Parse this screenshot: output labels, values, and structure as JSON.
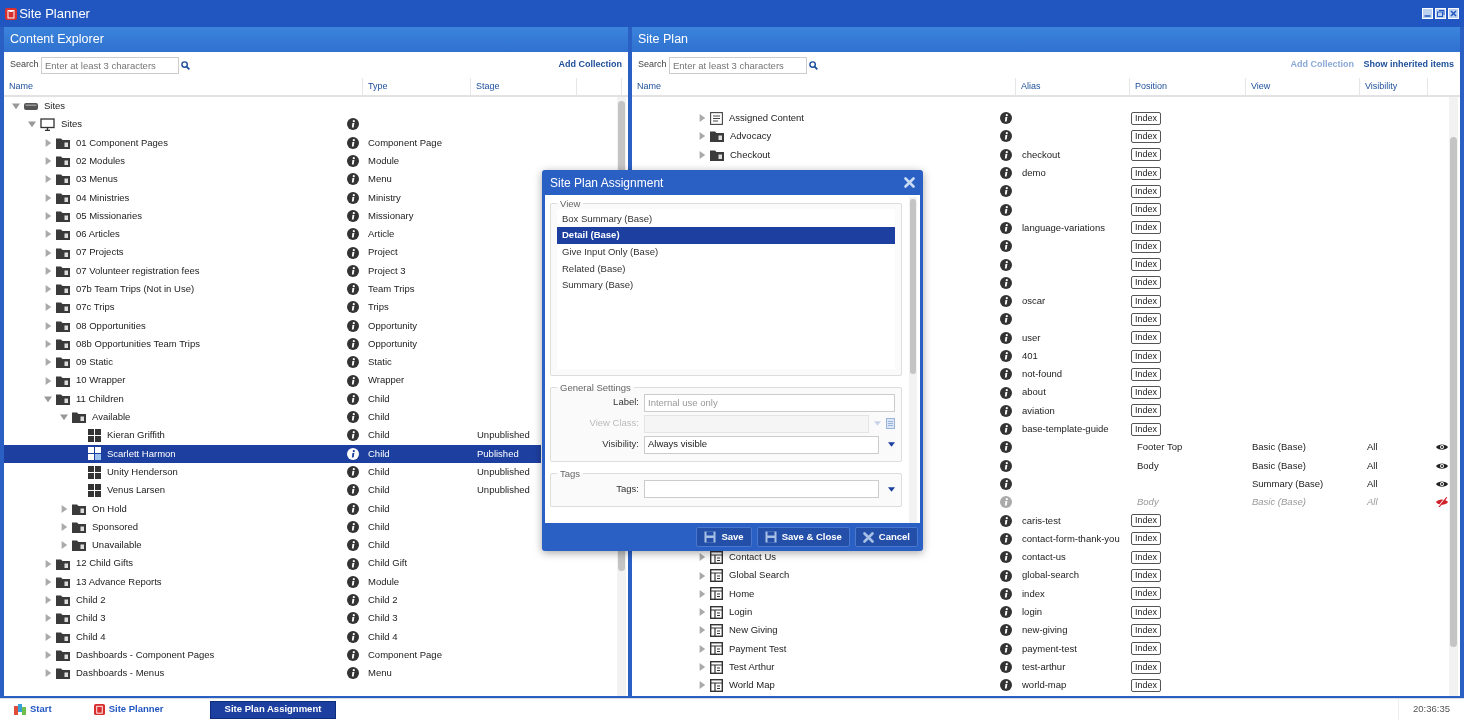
{
  "app": {
    "title": "Site Planner"
  },
  "content_explorer": {
    "title": "Content Explorer",
    "search": {
      "label": "Search",
      "placeholder": "Enter at least 3 characters"
    },
    "add_collection": "Add Collection",
    "columns": [
      "Name",
      "Type",
      "Stage"
    ],
    "tree": [
      {
        "name": "Sites",
        "kind": "root",
        "expanded": true,
        "selected": false,
        "children": [
          {
            "name": "Sites",
            "kind": "site",
            "expanded": true,
            "selected": false,
            "children": [
              {
                "name": "01 Component Pages",
                "type": "Component Page",
                "kind": "folder",
                "expanded": false,
                "selected": false
              },
              {
                "name": "02 Modules",
                "type": "Module",
                "kind": "folder",
                "expanded": false,
                "selected": false
              },
              {
                "name": "03 Menus",
                "type": "Menu",
                "kind": "folder",
                "expanded": false,
                "selected": false
              },
              {
                "name": "04 Ministries",
                "type": "Ministry",
                "kind": "folder",
                "expanded": false,
                "selected": false
              },
              {
                "name": "05 Missionaries",
                "type": "Missionary",
                "kind": "folder",
                "expanded": false,
                "selected": false
              },
              {
                "name": "06 Articles",
                "type": "Article",
                "kind": "folder",
                "expanded": false,
                "selected": false
              },
              {
                "name": "07 Projects",
                "type": "Project",
                "kind": "folder",
                "expanded": false,
                "selected": false
              },
              {
                "name": "07 Volunteer registration fees",
                "type": "Project 3",
                "kind": "folder",
                "expanded": false,
                "selected": false
              },
              {
                "name": "07b Team Trips (Not in Use)",
                "type": "Team Trips",
                "kind": "folder",
                "expanded": false,
                "selected": false
              },
              {
                "name": "07c Trips",
                "type": "Trips",
                "kind": "folder",
                "expanded": false,
                "selected": false
              },
              {
                "name": "08 Opportunities",
                "type": "Opportunity",
                "kind": "folder",
                "expanded": false,
                "selected": false
              },
              {
                "name": "08b Opportunities Team Trips",
                "type": "Opportunity",
                "kind": "folder",
                "expanded": false,
                "selected": false
              },
              {
                "name": "09 Static",
                "type": "Static",
                "kind": "folder",
                "expanded": false,
                "selected": false
              },
              {
                "name": "10 Wrapper",
                "type": "Wrapper",
                "kind": "folder",
                "expanded": false,
                "selected": false
              },
              {
                "name": "11 Children",
                "type": "Child",
                "kind": "folder",
                "expanded": true,
                "selected": false,
                "children": [
                  {
                    "name": "Available",
                    "type": "Child",
                    "kind": "folder",
                    "expanded": true,
                    "selected": false,
                    "children": [
                      {
                        "name": "Kieran Griffith",
                        "type": "Child",
                        "stage": "Unpublished",
                        "kind": "person",
                        "selected": false
                      },
                      {
                        "name": "Scarlett Harmon",
                        "type": "Child",
                        "stage": "Published",
                        "kind": "person",
                        "selected": true
                      },
                      {
                        "name": "Unity Henderson",
                        "type": "Child",
                        "stage": "Unpublished",
                        "kind": "person",
                        "selected": false
                      },
                      {
                        "name": "Venus Larsen",
                        "type": "Child",
                        "stage": "Unpublished",
                        "kind": "person",
                        "selected": false
                      }
                    ]
                  },
                  {
                    "name": "On Hold",
                    "type": "Child",
                    "kind": "folder",
                    "expanded": false,
                    "selected": false
                  },
                  {
                    "name": "Sponsored",
                    "type": "Child",
                    "kind": "folder",
                    "expanded": false,
                    "selected": false
                  },
                  {
                    "name": "Unavailable",
                    "type": "Child",
                    "kind": "folder",
                    "expanded": false,
                    "selected": false
                  }
                ]
              },
              {
                "name": "12 Child Gifts",
                "type": "Child Gift",
                "kind": "folder",
                "expanded": false,
                "selected": false
              },
              {
                "name": "13 Advance Reports",
                "type": "Module",
                "kind": "folder",
                "expanded": false,
                "selected": false
              },
              {
                "name": "Child 2",
                "type": "Child 2",
                "kind": "folder",
                "expanded": false,
                "selected": false
              },
              {
                "name": "Child 3",
                "type": "Child 3",
                "kind": "folder",
                "expanded": false,
                "selected": false
              },
              {
                "name": "Child 4",
                "type": "Child 4",
                "kind": "folder",
                "expanded": false,
                "selected": false
              },
              {
                "name": "Dashboards - Component Pages",
                "type": "Component Page",
                "kind": "folder",
                "expanded": false,
                "selected": false
              },
              {
                "name": "Dashboards - Menus",
                "type": "Menu",
                "kind": "folder",
                "expanded": false,
                "selected": false
              }
            ]
          }
        ]
      }
    ]
  },
  "site_plan": {
    "title": "Site Plan",
    "search": {
      "label": "Search",
      "placeholder": "Enter at least 3 characters"
    },
    "actions": [
      {
        "label": "Add Collection",
        "disabled": true
      },
      {
        "label": "Show inherited items",
        "disabled": false
      }
    ],
    "columns": [
      "Name",
      "Alias",
      "Position",
      "View",
      "Visibility"
    ],
    "rows": [
      {
        "name": "Assigned Content",
        "kind": "list",
        "expanded": false,
        "index_button": "Index",
        "inherited": false
      },
      {
        "name": "Advocacy",
        "kind": "folder",
        "expanded": false,
        "index_button": "Index",
        "inherited": false
      },
      {
        "name": "Checkout",
        "kind": "folder",
        "expanded": false,
        "alias": "checkout",
        "index_button": "Index",
        "inherited": false
      },
      {
        "alias": "demo",
        "index_button": "Index",
        "inherited": false
      },
      {
        "index_button": "Index",
        "inherited": false
      },
      {
        "index_button": "Index",
        "inherited": false
      },
      {
        "alias": "language-variations",
        "index_button": "Index",
        "inherited": false
      },
      {
        "index_button": "Index",
        "inherited": false
      },
      {
        "index_button": "Index",
        "inherited": false
      },
      {
        "index_button": "Index",
        "inherited": false
      },
      {
        "alias": "oscar",
        "index_button": "Index",
        "inherited": false
      },
      {
        "index_button": "Index",
        "inherited": false
      },
      {
        "alias": "user",
        "index_button": "Index",
        "inherited": false
      },
      {
        "alias": "401",
        "index_button": "Index",
        "inherited": false
      },
      {
        "alias": "not-found",
        "index_button": "Index",
        "inherited": false
      },
      {
        "alias": "about",
        "index_button": "Index",
        "inherited": false
      },
      {
        "alias": "aviation",
        "index_button": "Index",
        "inherited": false
      },
      {
        "alias": "base-template-guide",
        "index_button": "Index",
        "inherited": false
      },
      {
        "position": "Footer Top",
        "view": "Basic (Base)",
        "visibility": "All",
        "visible": true,
        "inherited": false
      },
      {
        "position": "Body",
        "view": "Basic (Base)",
        "visibility": "All",
        "visible": true,
        "inherited": false
      },
      {
        "view": "Summary (Base)",
        "visibility": "All",
        "visible": true,
        "inherited": false
      },
      {
        "position": "Body",
        "view": "Basic (Base)",
        "visibility": "All",
        "visible": false,
        "inherited": true
      },
      {
        "alias": "caris-test",
        "index_button": "Index",
        "inherited": false
      },
      {
        "alias": "contact-form-thank-you",
        "index_button": "Index",
        "inherited": false
      },
      {
        "name": "Contact Us",
        "kind": "page",
        "expanded": false,
        "alias": "contact-us",
        "index_button": "Index",
        "inherited": false
      },
      {
        "name": "Global Search",
        "kind": "page",
        "expanded": false,
        "alias": "global-search",
        "index_button": "Index",
        "inherited": false
      },
      {
        "name": "Home",
        "kind": "page",
        "expanded": false,
        "alias": "index",
        "index_button": "Index",
        "inherited": false
      },
      {
        "name": "Login",
        "kind": "page",
        "expanded": false,
        "alias": "login",
        "index_button": "Index",
        "inherited": false
      },
      {
        "name": "New Giving",
        "kind": "page",
        "expanded": false,
        "alias": "new-giving",
        "index_button": "Index",
        "inherited": false
      },
      {
        "name": "Payment Test",
        "kind": "page",
        "expanded": false,
        "alias": "payment-test",
        "index_button": "Index",
        "inherited": false
      },
      {
        "name": "Test Arthur",
        "kind": "page",
        "expanded": false,
        "alias": "test-arthur",
        "index_button": "Index",
        "inherited": false
      },
      {
        "name": "World Map",
        "kind": "page",
        "expanded": false,
        "alias": "world-map",
        "index_button": "Index",
        "inherited": false
      }
    ]
  },
  "dialog": {
    "title": "Site Plan Assignment",
    "view_section": {
      "legend": "View",
      "options": [
        {
          "label": "Box Summary (Base)",
          "selected": false
        },
        {
          "label": "Detail (Base)",
          "selected": true
        },
        {
          "label": "Give Input Only (Base)",
          "selected": false
        },
        {
          "label": "Related (Base)",
          "selected": false
        },
        {
          "label": "Summary (Base)",
          "selected": false
        }
      ]
    },
    "general_settings": {
      "legend": "General Settings",
      "fields": [
        {
          "label": "Label:",
          "kind": "text",
          "placeholder": "Internal use only",
          "disabled": false
        },
        {
          "label": "View Class:",
          "kind": "class",
          "disabled": true
        },
        {
          "label": "Visibility:",
          "kind": "select",
          "value": "Always visible",
          "disabled": false
        }
      ]
    },
    "tags": {
      "legend": "Tags",
      "fields": [
        {
          "label": "Tags:",
          "kind": "select",
          "disabled": false
        }
      ]
    },
    "buttons": [
      {
        "label": "Save",
        "kind": "save"
      },
      {
        "label": "Save & Close",
        "kind": "save"
      },
      {
        "label": "Cancel",
        "kind": "cancel"
      }
    ]
  },
  "taskbar": {
    "items": [
      {
        "label": "Start",
        "kind": "start",
        "selected": false
      },
      {
        "label": "Site Planner",
        "kind": "app",
        "selected": false
      },
      {
        "label": "Site Plan Assignment",
        "kind": "window",
        "selected": true
      }
    ],
    "clock": "20:36:35"
  }
}
